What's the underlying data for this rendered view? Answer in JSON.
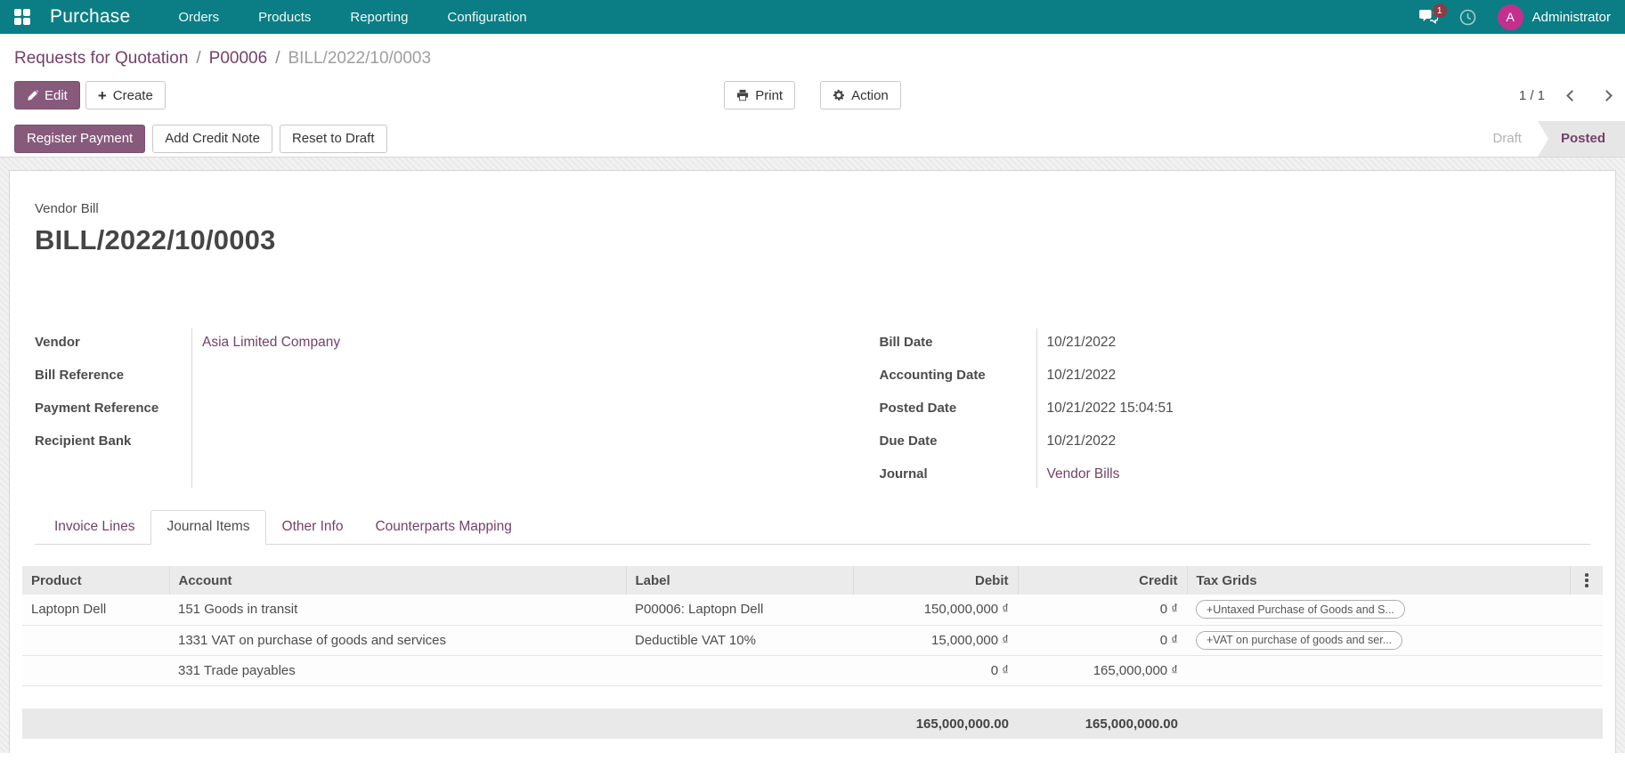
{
  "navbar": {
    "app_name": "Purchase",
    "menus": [
      {
        "label": "Orders"
      },
      {
        "label": "Products"
      },
      {
        "label": "Reporting"
      },
      {
        "label": "Configuration"
      }
    ],
    "message_badge": "1",
    "user_name": "Administrator",
    "avatar_initial": "A"
  },
  "breadcrumb": {
    "links": [
      {
        "label": "Requests for Quotation"
      },
      {
        "label": "P00006"
      }
    ],
    "separator": "/",
    "current": "BILL/2022/10/0003"
  },
  "control_panel": {
    "edit_label": "Edit",
    "create_label": "Create",
    "print_label": "Print",
    "action_label": "Action",
    "pager_value": "1 / 1"
  },
  "statusbar": {
    "buttons": [
      {
        "label": "Register Payment"
      },
      {
        "label": "Add Credit Note"
      },
      {
        "label": "Reset to Draft"
      }
    ],
    "states": {
      "draft": "Draft",
      "posted": "Posted"
    }
  },
  "document": {
    "type_label": "Vendor Bill",
    "title": "BILL/2022/10/0003",
    "fields_left": [
      {
        "label": "Vendor",
        "value": "Asia Limited Company"
      },
      {
        "label": "Bill Reference",
        "value": ""
      },
      {
        "label": "Payment Reference",
        "value": ""
      },
      {
        "label": "Recipient Bank",
        "value": ""
      }
    ],
    "fields_right": [
      {
        "label": "Bill Date",
        "value": "10/21/2022"
      },
      {
        "label": "Accounting Date",
        "value": "10/21/2022"
      },
      {
        "label": "Posted Date",
        "value": "10/21/2022 15:04:51"
      },
      {
        "label": "Due Date",
        "value": "10/21/2022"
      },
      {
        "label": "Journal",
        "value": "Vendor Bills"
      }
    ]
  },
  "tabs": [
    {
      "label": "Invoice Lines"
    },
    {
      "label": "Journal Items"
    },
    {
      "label": "Other Info"
    },
    {
      "label": "Counterparts Mapping"
    }
  ],
  "journal_items": {
    "columns": [
      "Product",
      "Account",
      "Label",
      "Debit",
      "Credit",
      "Tax Grids"
    ],
    "rows": [
      {
        "product": "Laptopn Dell",
        "account": "151 Goods in transit",
        "label": "P00006: Laptopn Dell",
        "debit": "150,000,000 ₫",
        "credit": "0 ₫",
        "tax_grid": "+Untaxed Purchase of Goods and S..."
      },
      {
        "product": "",
        "account": "1331 VAT on purchase of goods and services",
        "label": "Deductible VAT 10%",
        "debit": "15,000,000 ₫",
        "credit": "0 ₫",
        "tax_grid": "+VAT on purchase of goods and ser..."
      },
      {
        "product": "",
        "account": "331 Trade payables",
        "label": "",
        "debit": "0 ₫",
        "credit": "165,000,000 ₫",
        "tax_grid": ""
      }
    ],
    "totals": {
      "debit": "165,000,000.00",
      "credit": "165,000,000.00"
    }
  }
}
